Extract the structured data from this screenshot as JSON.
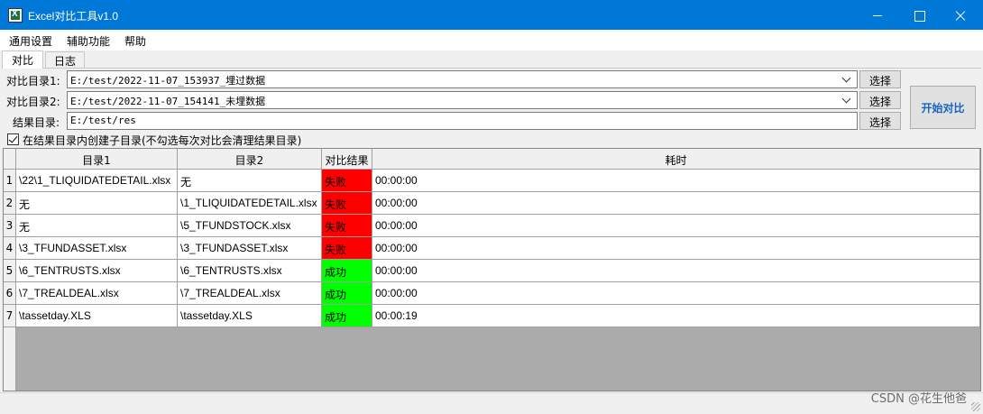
{
  "window": {
    "title": "Excel对比工具v1.0"
  },
  "menu": [
    "通用设置",
    "辅助功能",
    "帮助"
  ],
  "tabs": [
    "对比",
    "日志"
  ],
  "form": {
    "dir1_label": "对比目录1:",
    "dir1_value": "E:/test/2022-11-07_153937_埋过数据",
    "dir2_label": "对比目录2:",
    "dir2_value": "E:/test/2022-11-07_154141_未埋数据",
    "result_label": "结果目录:",
    "result_value": "E:/test/res",
    "select_label": "选择",
    "start_label": "开始对比",
    "checkbox_label": "在结果目录内创建子目录(不勾选每次对比会清理结果目录)",
    "checkbox_checked": true
  },
  "grid": {
    "columns": [
      "目录1",
      "目录2",
      "对比结果",
      "耗时"
    ],
    "rows": [
      {
        "n": "1",
        "dir1": "\\22\\1_TLIQUIDATEDETAIL.xlsx",
        "dir2": "无",
        "result": "失败",
        "time": "00:00:00"
      },
      {
        "n": "2",
        "dir1": "无",
        "dir2": "\\1_TLIQUIDATEDETAIL.xlsx",
        "result": "失败",
        "time": "00:00:00"
      },
      {
        "n": "3",
        "dir1": "无",
        "dir2": "\\5_TFUNDSTOCK.xlsx",
        "result": "失败",
        "time": "00:00:00"
      },
      {
        "n": "4",
        "dir1": "\\3_TFUNDASSET.xlsx",
        "dir2": "\\3_TFUNDASSET.xlsx",
        "result": "失败",
        "time": "00:00:00"
      },
      {
        "n": "5",
        "dir1": "\\6_TENTRUSTS.xlsx",
        "dir2": "\\6_TENTRUSTS.xlsx",
        "result": "成功",
        "time": "00:00:00"
      },
      {
        "n": "6",
        "dir1": "\\7_TREALDEAL.xlsx",
        "dir2": "\\7_TREALDEAL.xlsx",
        "result": "成功",
        "time": "00:00:00"
      },
      {
        "n": "7",
        "dir1": "\\tassetday.XLS",
        "dir2": "\\tassetday.XLS",
        "result": "成功",
        "time": "00:00:19"
      }
    ]
  },
  "colors": {
    "fail": "#ff0000",
    "success": "#00ff00",
    "titlebar": "#0078d7",
    "start_text": "#1565c0"
  },
  "watermark": "CSDN @花生他爸"
}
